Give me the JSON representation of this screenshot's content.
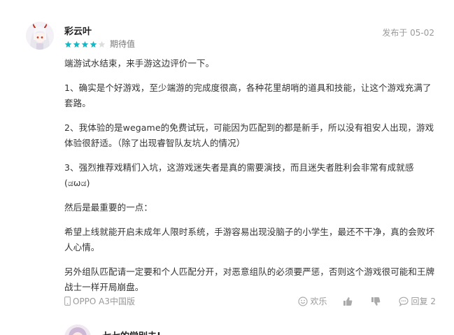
{
  "review": {
    "username": "彩云叶",
    "date_text": "发布于 05-02",
    "rating_value": 4,
    "rating_max": 5,
    "rating_label": "期待值",
    "paragraphs": [
      "端游试水结束，来手游这边评价一下。",
      "1、确实是个好游戏，至少端游的完成度很高，各种花里胡哨的道具和技能，让这个游戏充满了套路。",
      "2、我体验的是wegame的免费试玩，可能因为匹配到的都是新手，所以没有祖安人出现，游戏体验很舒适。（除了出现睿智队友坑人的情况）",
      "3、强烈推荐戏精们入坑，这游戏迷失者是真的需要演技，而且迷失者胜利会非常有成就感(ಡωಡ)",
      "然后是最重要的一点：",
      "希望上线就能开启未成年人限时系统，手游容易出现没脑子的小学生，最还不干净，真的会败坏人心情。",
      "另外组队匹配请一定要和个人匹配分开，对恶意组队的必须要严惩，否则这个游戏很可能和王牌战士一样开局崩盘。"
    ],
    "device": "OPPO A3中国版",
    "actions": {
      "fun_label": "欢乐",
      "reply_label": "回复 2"
    },
    "colors": {
      "star_filled": "#14b9c8",
      "star_empty": "#dddddd",
      "meta_gray": "#999999"
    },
    "icons": [
      "phone-icon",
      "smile-icon",
      "thumbs-up-icon",
      "thumbs-down-icon",
      "reply-bubble-icon"
    ]
  },
  "next_review": {
    "username": "七七的觉别去!"
  }
}
